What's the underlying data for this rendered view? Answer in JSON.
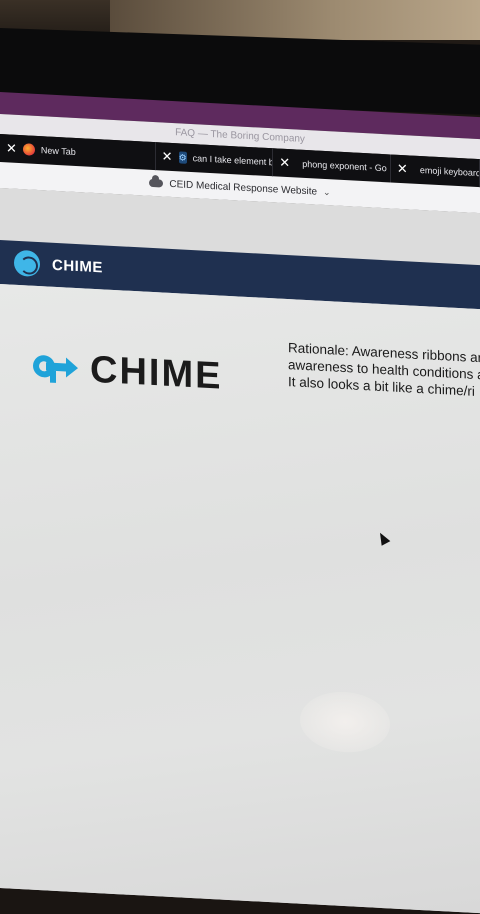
{
  "window": {
    "title": "FAQ — The Boring Company"
  },
  "tabs": [
    {
      "label": "New Tab",
      "icon": "firefox-icon"
    },
    {
      "label": "can I take element by",
      "icon": "stackoverflow-icon"
    },
    {
      "label": "phong exponent - Go",
      "icon": "google-icon"
    },
    {
      "label": "emoji keyboard",
      "icon": "google-icon"
    }
  ],
  "urlbar": {
    "label": "CEID Medical Response Website"
  },
  "header": {
    "title": "CHIME"
  },
  "main": {
    "logo_text": "CHIME",
    "rationale_lines": [
      "Rationale: Awareness ribbons are",
      "awareness to health conditions a",
      "It also looks a bit like a chime/ri"
    ]
  },
  "colors": {
    "header_bg": "#1f3050",
    "logo_blue": "#3fb6e8",
    "tab_bar": "#0f0f12"
  }
}
